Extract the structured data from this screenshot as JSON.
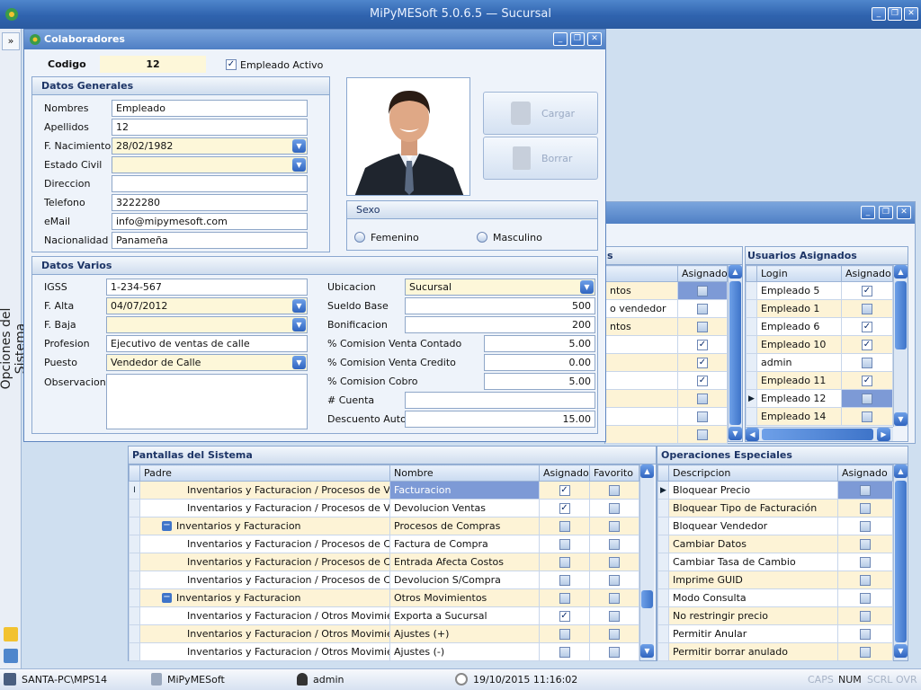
{
  "app": {
    "title": "MiPyMESoft 5.0.6.5 — Sucursal",
    "sidebar_label": "Opciones del Sistema"
  },
  "colab": {
    "title": "Colaboradores",
    "codigo_label": "Codigo",
    "codigo_value": "12",
    "empleado_activo": "Empleado Activo",
    "generales": {
      "header": "Datos Generales",
      "nombres_label": "Nombres",
      "nombres": "Empleado",
      "apellidos_label": "Apellidos",
      "apellidos": "12",
      "fnac_label": "F. Nacimiento",
      "fnac": "28/02/1982",
      "estado_label": "Estado Civil",
      "estado": "",
      "direccion_label": "Direccion",
      "direccion": "",
      "telefono_label": "Telefono",
      "telefono": "3222280",
      "email_label": "eMail",
      "email": "info@mipymesoft.com",
      "nacionalidad_label": "Nacionalidad",
      "nacionalidad": "Panameña"
    },
    "photo_buttons": {
      "cargar": "Cargar",
      "borrar": "Borrar"
    },
    "sexo": {
      "header": "Sexo",
      "femenino": "Femenino",
      "masculino": "Masculino"
    },
    "varios": {
      "header": "Datos Varios",
      "igss_label": "IGSS",
      "igss": "1-234-567",
      "falta_label": "F. Alta",
      "falta": "04/07/2012",
      "fbaja_label": "F. Baja",
      "fbaja": "",
      "profesion_label": "Profesion",
      "profesion": "Ejecutivo de ventas de calle",
      "puesto_label": "Puesto",
      "puesto": "Vendedor de Calle",
      "observacion_label": "Observacion",
      "ubicacion_label": "Ubicacion",
      "ubicacion": "Sucursal",
      "sueldo_label": "Sueldo Base",
      "sueldo": "500",
      "bonif_label": "Bonificacion",
      "bonif": "200",
      "cvc_label": "% Comision Venta Contado",
      "cvc": "5.00",
      "cvcr_label": "% Comision Venta Credito",
      "cvcr": "0.00",
      "cc_label": "% Comision Cobro",
      "cc": "5.00",
      "cuenta_label": "# Cuenta",
      "cuenta": "",
      "desc_label": "Descuento Auto.",
      "desc": "15.00"
    }
  },
  "partial": {
    "header_suffix": "s",
    "col": "Asignado",
    "rows": [
      {
        "text": "ntos",
        "check": false,
        "sel": true
      },
      {
        "text": "o vendedor",
        "check": false
      },
      {
        "text": "ntos",
        "check": false
      },
      {
        "text": "",
        "check": true
      },
      {
        "text": "",
        "check": true
      },
      {
        "text": "",
        "check": true
      },
      {
        "text": "",
        "check": false
      },
      {
        "text": "",
        "check": false
      },
      {
        "text": "",
        "check": false
      }
    ]
  },
  "usuarios": {
    "header": "Usuarios Asignados",
    "col_login": "Login",
    "col_asignado": "Asignado",
    "rows": [
      {
        "login": "Empleado 5",
        "check": true
      },
      {
        "login": "Empleado 1",
        "check": false
      },
      {
        "login": "Empleado 6",
        "check": true
      },
      {
        "login": "Empleado 10",
        "check": true
      },
      {
        "login": "admin",
        "check": false
      },
      {
        "login": "Empleado 11",
        "check": true
      },
      {
        "login": "Empleado 12",
        "check": false,
        "sel": true
      },
      {
        "login": "Empleado 14",
        "check": false
      }
    ]
  },
  "pantallas": {
    "header": "Pantallas del Sistema",
    "col_padre": "Padre",
    "col_nombre": "Nombre",
    "col_asignado": "Asignado",
    "col_favorito": "Favorito",
    "rows": [
      {
        "padre": "Inventarios y Facturacion / Procesos de Venta",
        "nombre": "Facturacion",
        "asig": true,
        "fav": false,
        "level": 2,
        "sel": true
      },
      {
        "padre": "Inventarios y Facturacion / Procesos de Venta",
        "nombre": "Devolucion Ventas",
        "asig": true,
        "fav": false,
        "level": 2
      },
      {
        "padre": "Inventarios y Facturacion",
        "nombre": "Procesos de Compras",
        "asig": false,
        "fav": false,
        "level": 1
      },
      {
        "padre": "Inventarios y Facturacion / Procesos de Compras",
        "nombre": "Factura de Compra",
        "asig": false,
        "fav": false,
        "level": 2
      },
      {
        "padre": "Inventarios y Facturacion / Procesos de Compras",
        "nombre": "Entrada Afecta Costos",
        "asig": false,
        "fav": false,
        "level": 2
      },
      {
        "padre": "Inventarios y Facturacion / Procesos de Compras",
        "nombre": "Devolucion S/Compra",
        "asig": false,
        "fav": false,
        "level": 2
      },
      {
        "padre": "Inventarios y Facturacion",
        "nombre": "Otros Movimientos",
        "asig": false,
        "fav": false,
        "level": 1
      },
      {
        "padre": "Inventarios y Facturacion / Otros Movimientos",
        "nombre": "Exporta a Sucursal",
        "asig": true,
        "fav": false,
        "level": 2
      },
      {
        "padre": "Inventarios y Facturacion / Otros Movimientos",
        "nombre": "Ajustes (+)",
        "asig": false,
        "fav": false,
        "level": 2
      },
      {
        "padre": "Inventarios y Facturacion / Otros Movimientos",
        "nombre": "Ajustes (-)",
        "asig": false,
        "fav": false,
        "level": 2
      }
    ]
  },
  "operaciones": {
    "header": "Operaciones Especiales",
    "col_desc": "Descripcion",
    "col_asignado": "Asignado",
    "rows": [
      {
        "desc": "Bloquear Precio",
        "check": false,
        "sel": true
      },
      {
        "desc": "Bloquear Tipo de Facturación",
        "check": false
      },
      {
        "desc": "Bloquear Vendedor",
        "check": false
      },
      {
        "desc": "Cambiar Datos",
        "check": false
      },
      {
        "desc": "Cambiar Tasa de Cambio",
        "check": false
      },
      {
        "desc": "Imprime GUID",
        "check": false
      },
      {
        "desc": "Modo Consulta",
        "check": false
      },
      {
        "desc": "No restringir precio",
        "check": false
      },
      {
        "desc": "Permitir Anular",
        "check": false
      },
      {
        "desc": "Permitir borrar anulado",
        "check": false
      }
    ]
  },
  "status": {
    "machine": "SANTA-PC\\MPS14",
    "app": "MiPyMESoft",
    "user": "admin",
    "datetime": "19/10/2015 11:16:02",
    "caps": "CAPS",
    "num": "NUM",
    "scrl": "SCRL",
    "ovr": "OVR"
  },
  "colors": {
    "accent": "#2f63ae",
    "row_alt": "#fdf3d6",
    "row_sel": "#7d9ad6"
  }
}
